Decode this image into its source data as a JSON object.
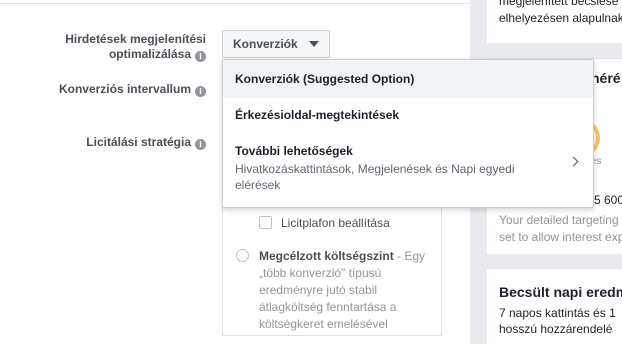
{
  "form": {
    "optimization_label_line1": "Hirdetések megjelenítési",
    "optimization_label_line2": "optimalizálása",
    "conversion_window_label": "Konverziós intervallum",
    "bid_strategy_label": "Licitálási stratégia",
    "optimization_value": "Konverziók"
  },
  "menu": {
    "items": [
      {
        "label": "Konverziók (Suggested Option)"
      },
      {
        "label": "Érkezésioldal-megtekintések"
      },
      {
        "label": "További lehetőségek",
        "description": "Hivatkozáskattintások, Megjelenések és Napi egyedi elérések"
      }
    ]
  },
  "bid": {
    "cap_checkbox_label": "Licitplafon beállítása",
    "target_cost_title": "Megcélzott költségszint",
    "target_cost_desc": " - Egy „több konverzió\" típusú eredményre jutó stabil átlagköltség fenntartása a költségkeret emelésével"
  },
  "right": {
    "card1_line1": "megjelenített becslése",
    "card1_line2": "elhelyezésen alapulnak",
    "card2_title_fragment": "néré",
    "gauge_label": "eles",
    "number_fragment": "5 600",
    "targeting_line1": "Your detailed targeting",
    "targeting_line2": "set to allow interest exp",
    "card3_title": "Becsült napi eredm",
    "card3_line1": "7 napos kattintás és 1",
    "card3_line2": "hosszú hozzárendelé"
  },
  "colors": {
    "page_bg": "#e9ebee",
    "highlight": "#f2f3f5",
    "text_dark": "#1d2129",
    "text_gray": "#90949c",
    "gauge": "#f7c36b"
  }
}
